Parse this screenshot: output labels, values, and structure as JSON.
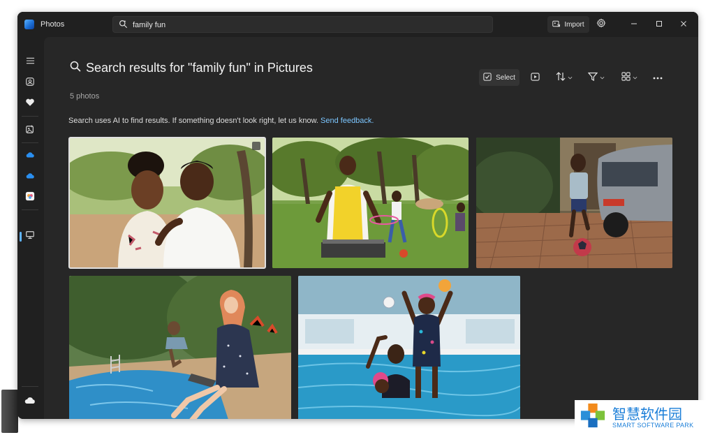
{
  "app": {
    "title": "Photos"
  },
  "search": {
    "value": "family fun"
  },
  "titlebar": {
    "import_label": "Import"
  },
  "results": {
    "title": "Search results for \"family fun\" in Pictures",
    "count": "5 photos",
    "notice": "Search uses AI to find results. If something doesn't look right, let us know.",
    "feedback_link": "Send feedback."
  },
  "toolbar": {
    "select_label": "Select"
  },
  "icons": {
    "menu": "hamburger-menu-icon",
    "gallery": "gallery-icon",
    "favorites": "heart-icon",
    "people": "image-edit-icon",
    "onedrive": "cloud-icon",
    "icloud": "icloud-icon",
    "pc": "monitor-icon"
  },
  "photos": [
    {
      "subject": "couple laughing outdoors",
      "selected": true
    },
    {
      "subject": "family barbecue in park",
      "selected": false
    },
    {
      "subject": "boy with soccer ball",
      "selected": false
    },
    {
      "subject": "woman at poolside with laptop",
      "selected": false
    },
    {
      "subject": "children in swimming pool",
      "selected": false
    }
  ],
  "watermark": {
    "cn": "智慧软件园",
    "en": "SMART SOFTWARE PARK"
  },
  "colors": {
    "accent": "#60b4ff",
    "link": "#7cc6ff",
    "window_bg": "#202020",
    "main_bg": "#272727"
  }
}
